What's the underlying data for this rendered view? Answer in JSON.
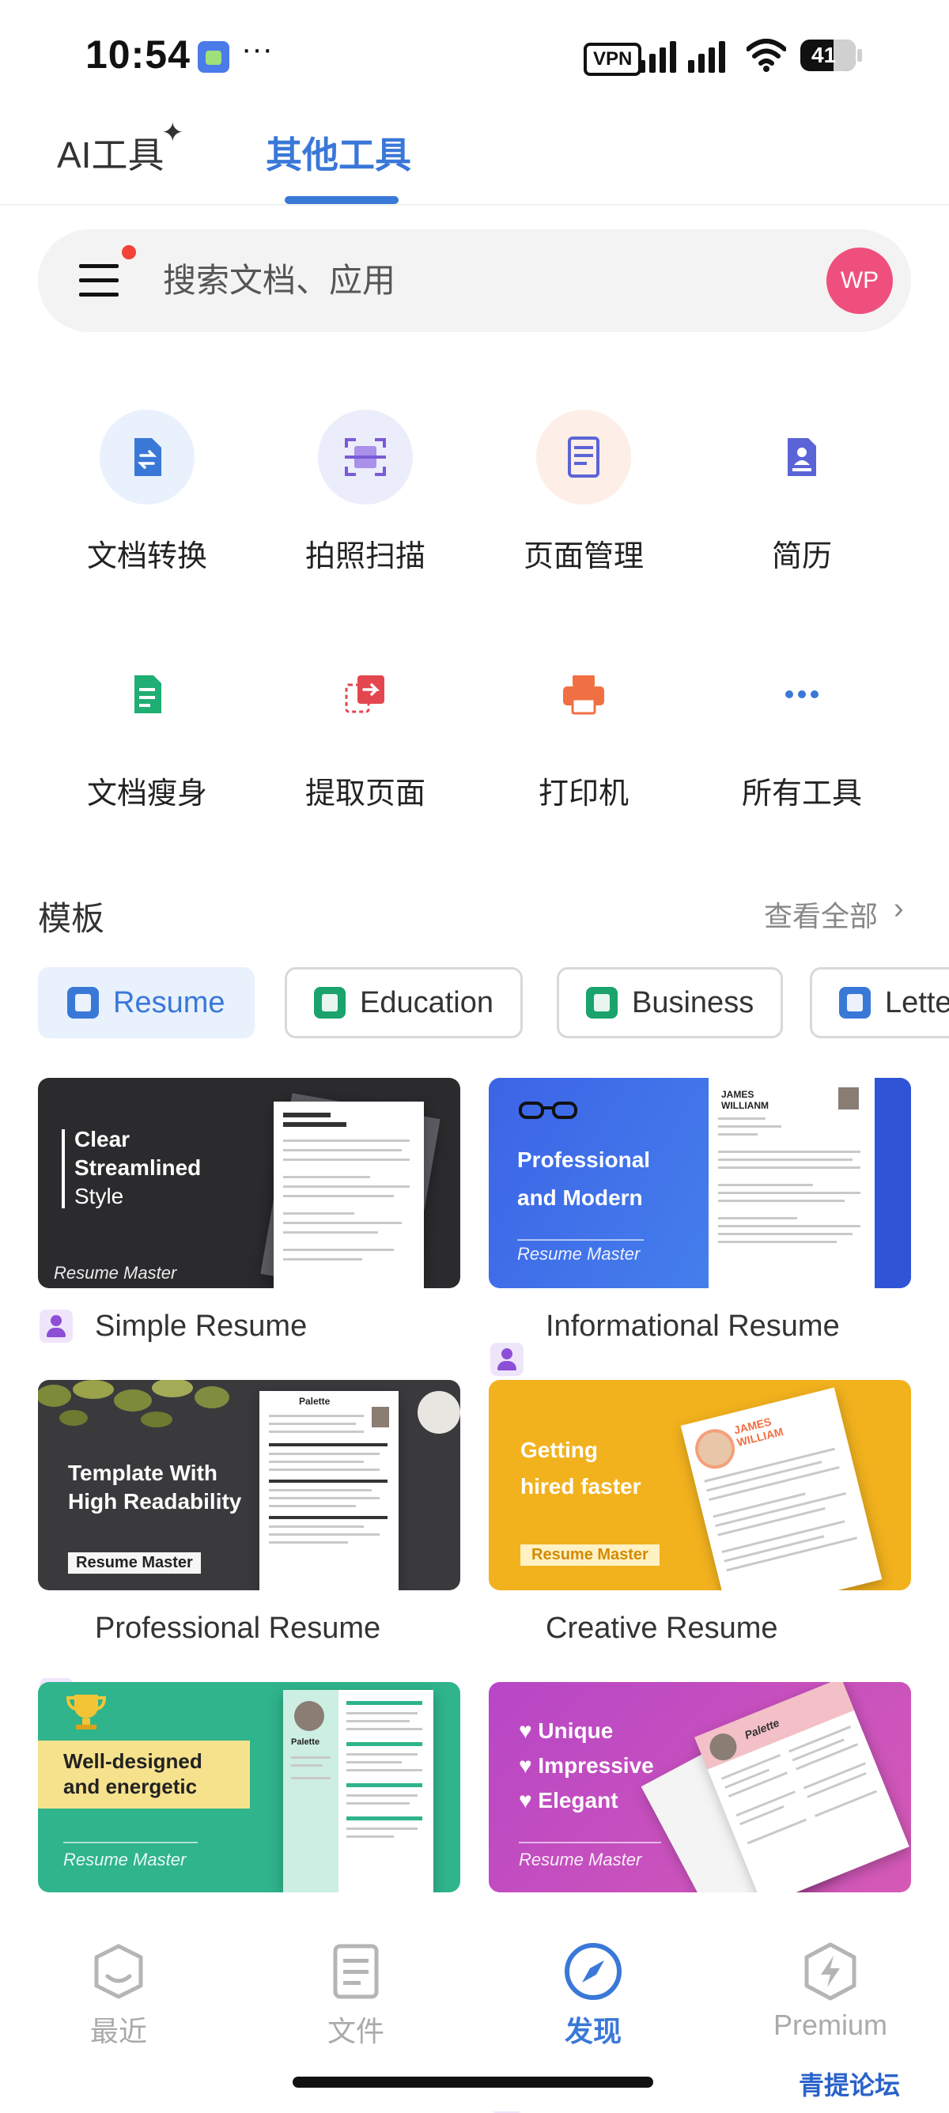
{
  "status_bar": {
    "time": "10:54",
    "dots": "···",
    "vpn": "VPN",
    "battery": "41"
  },
  "top_tabs": [
    {
      "label": "AI工具"
    },
    {
      "label": "其他工具"
    }
  ],
  "search": {
    "placeholder": "搜索文档、应用",
    "avatar_initials": "WP"
  },
  "tools": [
    {
      "label": "文档转换",
      "icon": "file-convert-icon",
      "bg": "#e9f1fd",
      "fg": "#3a78d8"
    },
    {
      "label": "拍照扫描",
      "icon": "scan-icon",
      "bg": "#efebfb",
      "fg": "#7a5bd6"
    },
    {
      "label": "页面管理",
      "icon": "page-manage-icon",
      "bg": "#ecedfb",
      "fg": "#5b64d6"
    },
    {
      "label": "简历",
      "icon": "resume-icon",
      "bg": "#ecedfb",
      "fg": "#5b64d6"
    },
    {
      "label": "文档瘦身",
      "icon": "compress-icon",
      "bg": "#e8f7f0",
      "fg": "#1fae73"
    },
    {
      "label": "提取页面",
      "icon": "extract-page-icon",
      "bg": "#fdecec",
      "fg": "#e4464f"
    },
    {
      "label": "打印机",
      "icon": "printer-icon",
      "bg": "#fdeee8",
      "fg": "#f07043"
    },
    {
      "label": "所有工具",
      "icon": "more-icon",
      "bg": "#e9f1fd",
      "fg": "#3a78d8"
    }
  ],
  "templates": {
    "title": "模板",
    "see_all": "查看全部",
    "chips": [
      {
        "label": "Resume",
        "color": "#3a78d8"
      },
      {
        "label": "Education",
        "color": "#1aa36c"
      },
      {
        "label": "Business",
        "color": "#1aa36c"
      },
      {
        "label": "Letter",
        "color": "#3a78d8"
      }
    ],
    "cards": [
      {
        "label": "Simple Resume",
        "headline": [
          "Clear",
          "Streamlined",
          "Style"
        ],
        "brand": "Resume Master",
        "bg": "#2b2b2e"
      },
      {
        "label": "Informational Resume",
        "headline": [
          "Professional",
          "and Modern"
        ],
        "brand": "Resume Master",
        "bg": "#3d6fe6",
        "name": [
          "JAMES",
          "WILLIANM"
        ]
      },
      {
        "label": "Professional Resume",
        "headline": [
          "Template With",
          "High Readability"
        ],
        "brand": "Resume Master",
        "bg": "#3a3a3d",
        "paper_title": "Palette"
      },
      {
        "label": "Creative Resume",
        "headline": [
          "Getting",
          "hired faster"
        ],
        "brand": "Resume Master",
        "bg": "#f2b21e",
        "name": [
          "JAMES",
          "WILLIAM"
        ]
      },
      {
        "label": "",
        "headline": [
          "Well-designed",
          "and energetic"
        ],
        "brand": "Resume Master",
        "bg": "#2fb48c",
        "paper_title": "Palette"
      },
      {
        "label": "",
        "headline": [
          "♥ Unique",
          "♥ Impressive",
          "♥ Elegant"
        ],
        "brand": "Resume Master",
        "bg": "#c64fbe",
        "paper_title": "Palette"
      }
    ]
  },
  "bottom_nav": [
    {
      "label": "最近",
      "icon": "recent-icon"
    },
    {
      "label": "文件",
      "icon": "files-icon"
    },
    {
      "label": "发现",
      "icon": "discover-compass-icon"
    },
    {
      "label": "Premium",
      "icon": "premium-bolt-icon"
    }
  ],
  "watermark": "青提论坛"
}
